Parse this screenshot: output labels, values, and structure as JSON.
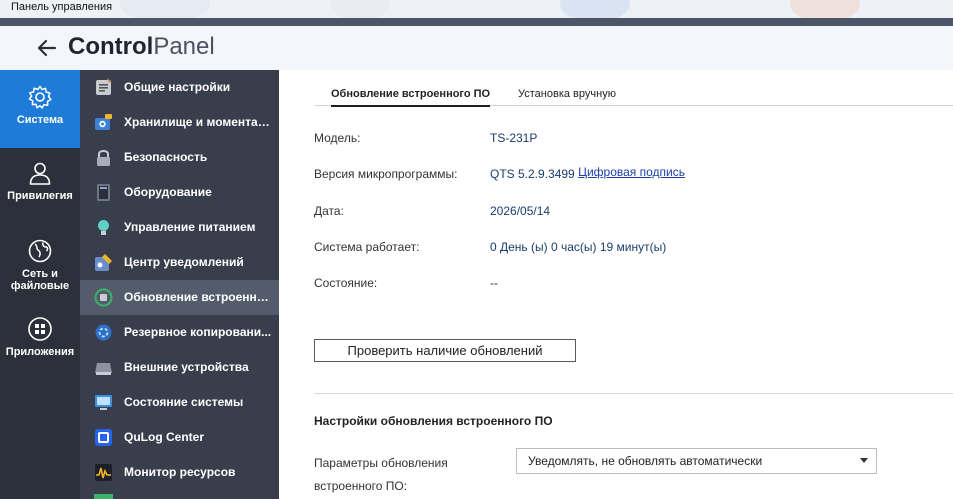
{
  "window": {
    "title": "Панель управления"
  },
  "header": {
    "title_bold": "Control",
    "title_light": "Panel"
  },
  "rail": {
    "items": [
      {
        "label": "Система",
        "icon": "gear-icon",
        "active": true
      },
      {
        "label": "Привилегия",
        "icon": "user-icon",
        "active": false
      },
      {
        "label": "Сеть и файловые",
        "icon": "globe-icon",
        "active": false
      },
      {
        "label": "Приложения",
        "icon": "apps-grid-icon",
        "active": false
      }
    ]
  },
  "menu": {
    "items": [
      {
        "label": "Общие настройки",
        "icon": "general-settings-icon",
        "active": false
      },
      {
        "label": "Хранилище и моментал...",
        "icon": "storage-snapshots-icon",
        "active": false
      },
      {
        "label": "Безопасность",
        "icon": "lock-icon",
        "active": false
      },
      {
        "label": "Оборудование",
        "icon": "hardware-icon",
        "active": false
      },
      {
        "label": "Управление питанием",
        "icon": "power-bulb-icon",
        "active": false
      },
      {
        "label": "Центр уведомлений",
        "icon": "notification-center-icon",
        "active": false
      },
      {
        "label": "Обновление встроенно...",
        "icon": "firmware-update-icon",
        "active": true
      },
      {
        "label": "Резервное копировани...",
        "icon": "backup-icon",
        "active": false
      },
      {
        "label": "Внешние устройства",
        "icon": "external-device-icon",
        "active": false
      },
      {
        "label": "Состояние системы",
        "icon": "system-status-icon",
        "active": false
      },
      {
        "label": "QuLog Center",
        "icon": "qulog-icon",
        "active": false
      },
      {
        "label": "Монитор ресурсов",
        "icon": "resource-monitor-icon",
        "active": false
      }
    ]
  },
  "tabs": [
    {
      "label": "Обновление встроенного ПО",
      "active": true
    },
    {
      "label": "Установка вручную",
      "active": false
    }
  ],
  "info": {
    "model_label": "Модель:",
    "model_value": "TS-231P",
    "fw_label": "Версия микропрограммы:",
    "fw_value": "QTS 5.2.9.3499",
    "fw_link": "Цифровая подпись",
    "date_label": "Дата:",
    "date_value": "2026/05/14",
    "uptime_label": "Система работает:",
    "uptime_value": "0 День (ы) 0 час(ы) 19 минут(ы)",
    "state_label": "Состояние:",
    "state_value": "--"
  },
  "check_button": "Проверить наличие обновлений",
  "settings": {
    "title": "Настройки обновления встроенного ПО",
    "param_label_line1": "Параметры обновления",
    "param_label_line2": "встроенного ПО:",
    "param_value": "Уведомлять, не обновлять автоматически"
  },
  "colors": {
    "accent": "#1f7bd8",
    "rail_bg": "#2b303b",
    "menu_bg": "#383e4b",
    "menu_active": "#545c6c"
  }
}
